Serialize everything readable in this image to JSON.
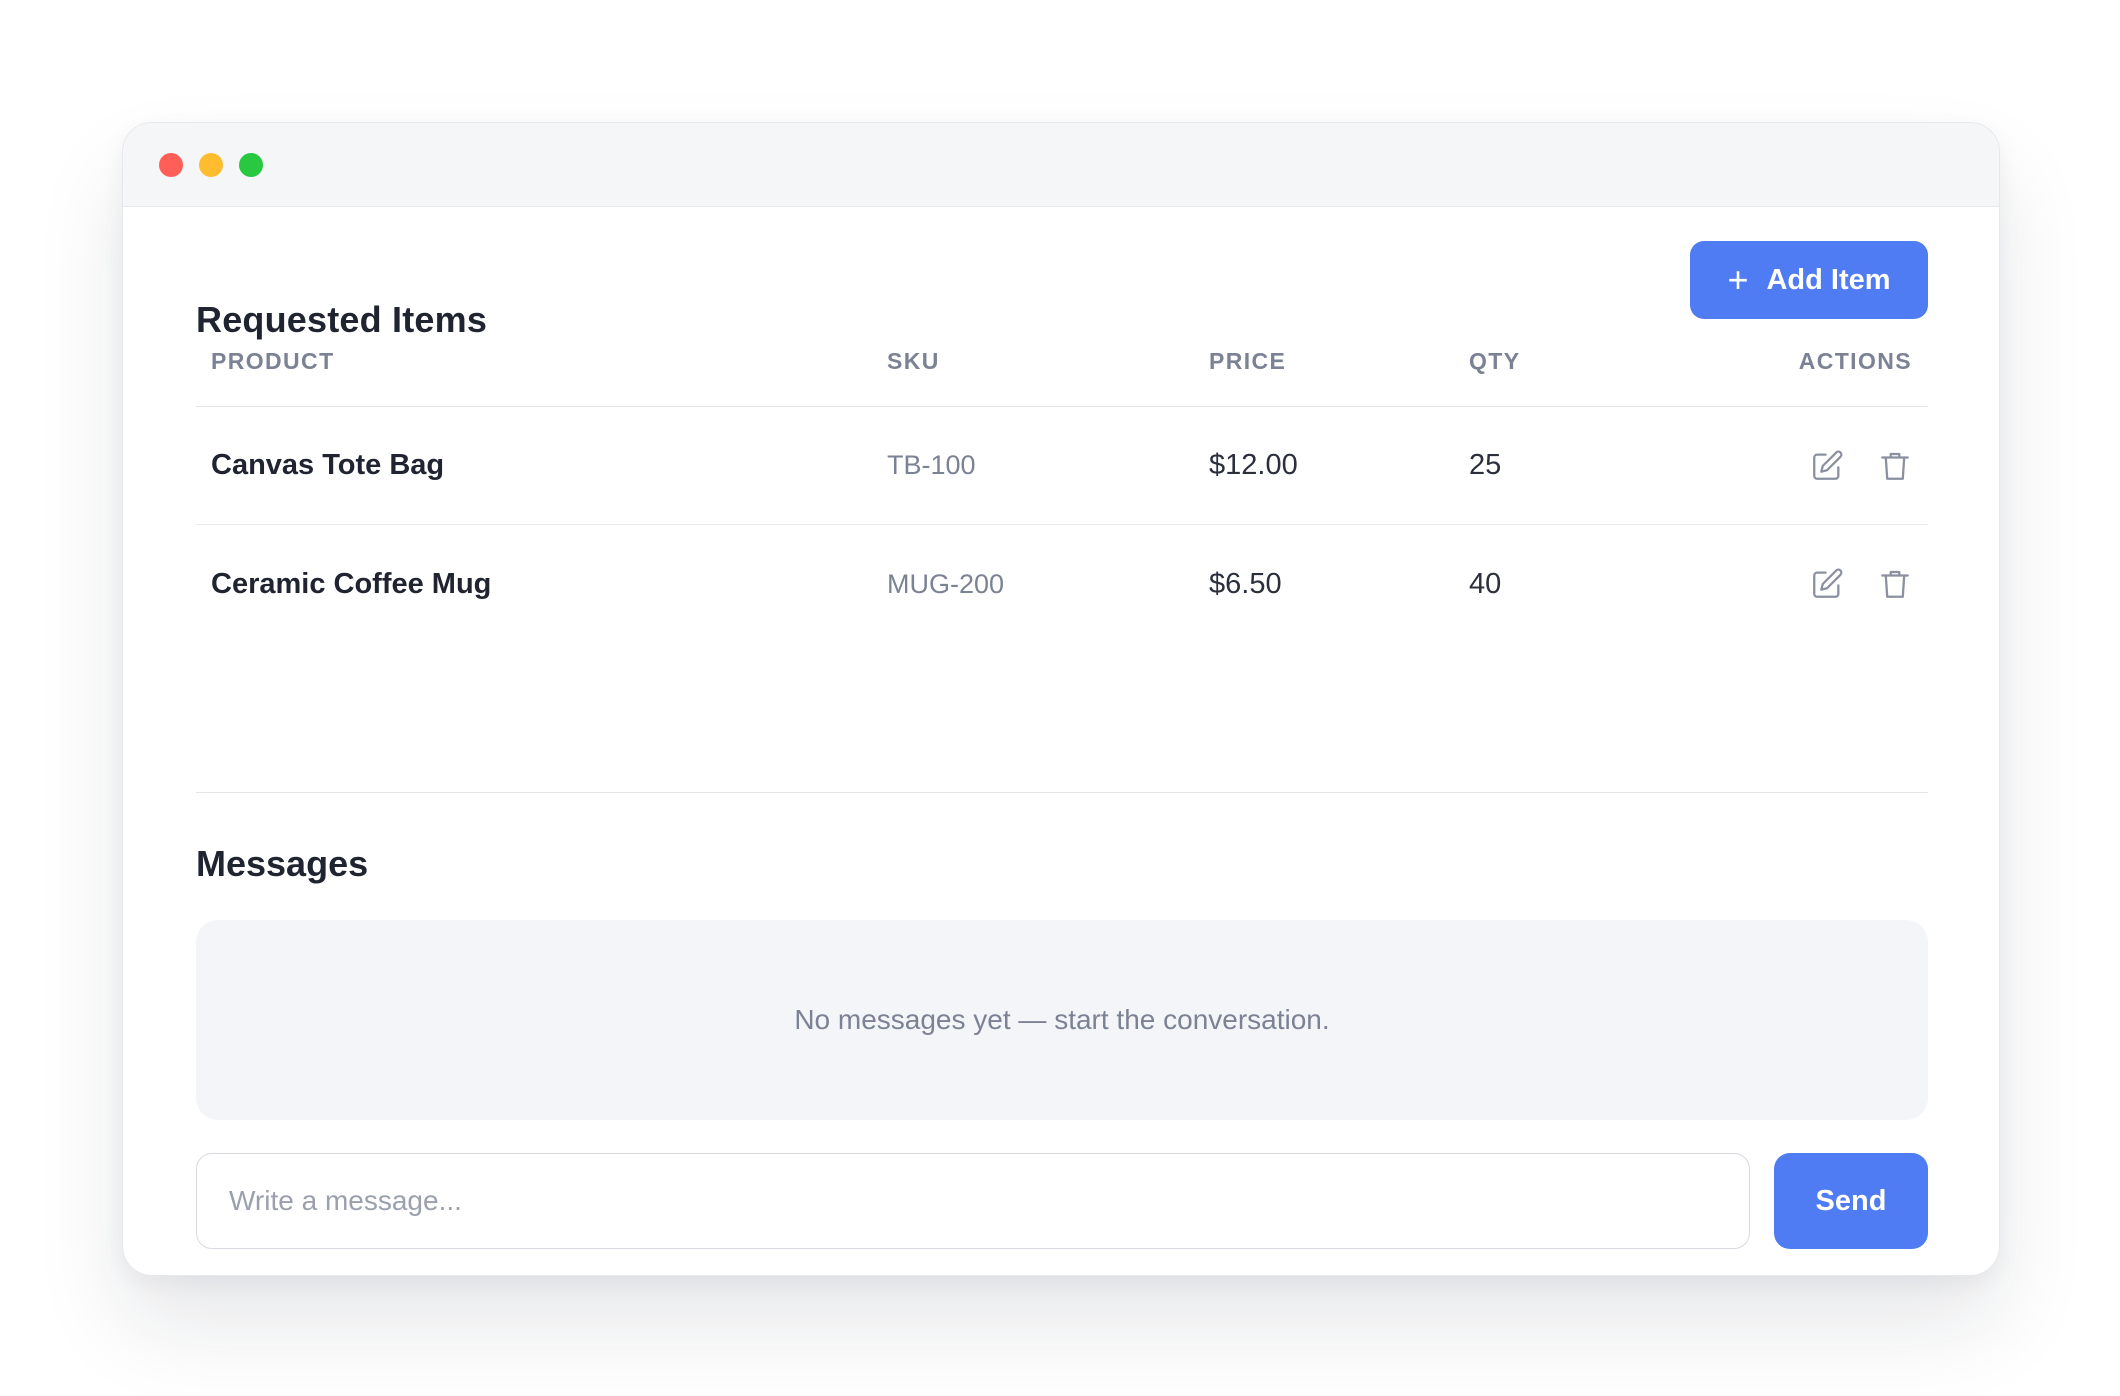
{
  "window": {
    "controls": [
      "close",
      "minimize",
      "maximize"
    ]
  },
  "items_section": {
    "title": "Requested Items",
    "add_button": {
      "icon": "plus-icon",
      "label": "Add Item"
    },
    "columns": [
      "PRODUCT",
      "SKU",
      "PRICE",
      "QTY",
      "ACTIONS"
    ],
    "rows": [
      {
        "product": "Canvas Tote Bag",
        "sku": "TB-100",
        "price": "$12.00",
        "qty": "25"
      },
      {
        "product": "Ceramic Coffee Mug",
        "sku": "MUG-200",
        "price": "$6.50",
        "qty": "40"
      }
    ]
  },
  "messages_section": {
    "title": "Messages",
    "empty_text": "No messages yet — start the conversation.",
    "input_placeholder": "Write a message...",
    "send_label": "Send"
  },
  "colors": {
    "accent": "#4f7bf3",
    "dot_red": "#ff5f57",
    "dot_yellow": "#febc2e",
    "dot_green": "#28c840"
  }
}
